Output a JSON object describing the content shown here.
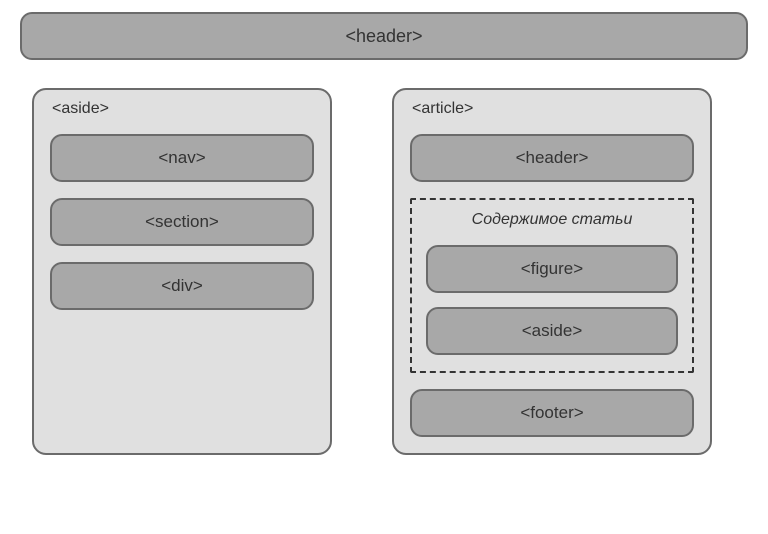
{
  "header": {
    "label": "<header>"
  },
  "aside": {
    "label": "<aside>",
    "items": [
      {
        "label": "<nav>"
      },
      {
        "label": "<section>"
      },
      {
        "label": "<div>"
      }
    ]
  },
  "article": {
    "label": "<article>",
    "header_label": "<header>",
    "content": {
      "title": "Содержимое статьи",
      "items": [
        {
          "label": "<figure>"
        },
        {
          "label": "<aside>"
        }
      ]
    },
    "footer_label": "<footer>"
  }
}
